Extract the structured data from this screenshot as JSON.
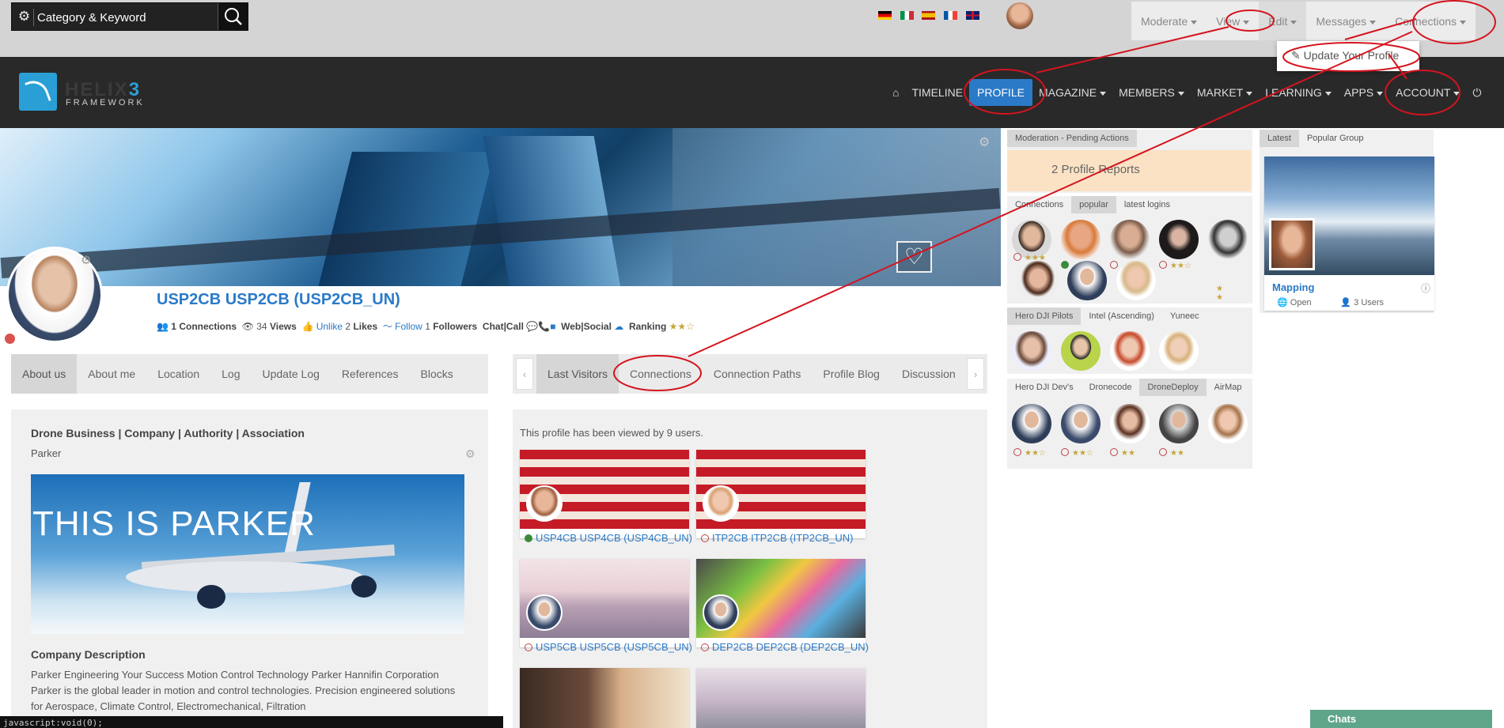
{
  "search": {
    "placeholder": "Category & Keyword"
  },
  "flags": [
    {
      "name": "de",
      "colors": [
        "#000000",
        "#dd0000",
        "#ffce00"
      ]
    },
    {
      "name": "it",
      "colors": [
        "#009246",
        "#ffffff",
        "#ce2b37"
      ]
    },
    {
      "name": "es",
      "colors": [
        "#aa151b",
        "#f1bf00",
        "#aa151b"
      ]
    },
    {
      "name": "fr",
      "colors": [
        "#0055a4",
        "#ffffff",
        "#ef4135"
      ]
    },
    {
      "name": "uk",
      "colors": [
        "#012169",
        "#c8102e",
        "#012169"
      ]
    }
  ],
  "topmenu": {
    "moderate": "Moderate",
    "view": "View",
    "edit": "Edit",
    "messages": "Messages",
    "connections": "Connections"
  },
  "editdrop": {
    "update_profile": "Update Your Profile"
  },
  "logo": {
    "text": "HELIX",
    "num": "3",
    "sub": "FRAMEWORK"
  },
  "nav": {
    "timeline": "TIMELINE",
    "profile": "PROFILE",
    "magazine": "MAGAZINE",
    "members": "MEMBERS",
    "market": "MARKET",
    "learning": "LEARNING",
    "apps": "APPS",
    "account": "ACCOUNT"
  },
  "profile": {
    "name": "USP2CB USP2CB (USP2CB_UN)",
    "connections_count": "1",
    "connections_label": "Connections",
    "views_count": "34",
    "views_label": "Views",
    "unlike": "Unlike",
    "likes_count": "2",
    "likes_label": "Likes",
    "follow": "Follow",
    "followers_count": "1",
    "followers_label": "Followers",
    "chatcall": "Chat|Call",
    "websocial": "Web|Social",
    "ranking": "Ranking"
  },
  "tabs_left": [
    "About us",
    "About me",
    "Location",
    "Log",
    "Update Log",
    "References",
    "Blocks"
  ],
  "tabs_right": [
    "Last Visitors",
    "Connections",
    "Connection Paths",
    "Profile Blog",
    "Discussion"
  ],
  "about": {
    "title": "Drone Business | Company | Authority | Association",
    "subtitle": "Parker",
    "image_text": "THIS IS PARKER",
    "desc_title": "Company Description",
    "desc_text": "Parker Engineering Your Success Motion Control Technology Parker Hannifin Corporation Parker is the global leader in motion and control technologies. Precision engineered solutions for Aerospace, Climate Control, Electromechanical, Filtration"
  },
  "visitors": {
    "note": "This profile has been viewed by 9 users.",
    "items": [
      {
        "name": "USP4CB USP4CB (USP4CB_UN)",
        "online": true
      },
      {
        "name": "ITP2CB ITP2CB (ITP2CB_UN)",
        "online": false
      },
      {
        "name": "USP5CB USP5CB (USP5CB_UN)",
        "online": false
      },
      {
        "name": "DEP2CB DEP2CB (DEP2CB_UN)",
        "online": false
      }
    ]
  },
  "moderation": {
    "tab": "Moderation - Pending Actions",
    "note": "2 Profile Reports"
  },
  "connections_widget": {
    "tabs": [
      "Connections",
      "popular",
      "latest logins"
    ]
  },
  "pilots_widget": {
    "tabs": [
      "Hero DJI Pilots",
      "Intel (Ascending)",
      "Yuneec"
    ]
  },
  "devs_widget": {
    "tabs": [
      "Hero DJI Dev's",
      "Dronecode",
      "DroneDeploy",
      "AirMap"
    ]
  },
  "groups": {
    "tabs": [
      "Latest",
      "Popular Group"
    ],
    "name": "Mapping",
    "status": "Open",
    "users": "3 Users"
  },
  "chats": "Chats",
  "statusbar": "javascript:void(0);",
  "colors": {
    "accent": "#2a7ac8",
    "annotation": "#d4141f"
  }
}
